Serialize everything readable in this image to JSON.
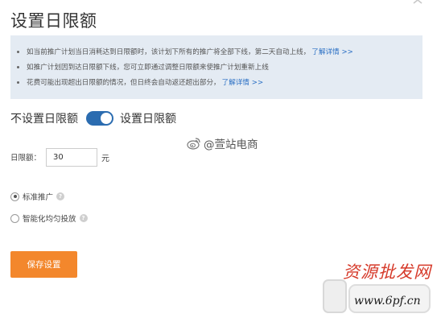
{
  "dialog": {
    "title": "设置日限额"
  },
  "info": {
    "lines": [
      {
        "text": "如当前推广计划当日消耗达到日限额时，该计划下所有的推广将全部下线，第二天自动上线，",
        "link": "了解详情 >>"
      },
      {
        "text": "如推广计划因到达日限额下线，您可立即通过调整日限额来使推广计划重新上线",
        "link": ""
      },
      {
        "text": "花费可能出现超出日限额的情况，但日终会自动返还超出部分，",
        "link": "了解详情 >>"
      }
    ]
  },
  "toggle": {
    "off_label": "不设置日限额",
    "on_label": "设置日限额",
    "state": "on"
  },
  "budget": {
    "label": "日限额：",
    "value": "30",
    "unit": "元"
  },
  "radios": [
    {
      "label": "标准推广",
      "checked": true
    },
    {
      "label": "智能化均匀投放",
      "checked": false
    }
  ],
  "actions": {
    "save_label": "保存设置"
  },
  "watermarks": {
    "weibo_handle": "@萱站电商",
    "corner_text": "资源批发网",
    "corner_url": "www.6pf.cn"
  },
  "colors": {
    "accent_orange": "#f3872c",
    "info_bg": "#e4ebf3",
    "link_blue": "#2a6fc4",
    "switch_on": "#2b6cb0"
  }
}
